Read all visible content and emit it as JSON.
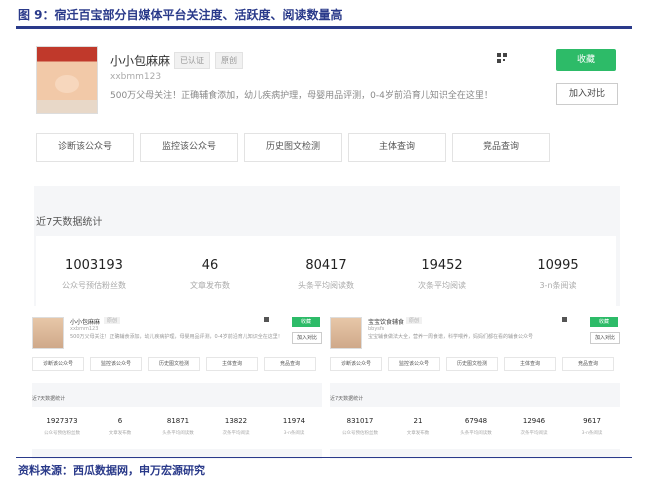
{
  "figure_title": "图 9：宿迁百宝部分自媒体平台关注度、活跃度、阅读数量高",
  "source": "资料来源：西瓜数据网，申万宏源研究",
  "main": {
    "name": "小小包麻麻",
    "tags": [
      "已认证",
      "原创"
    ],
    "id": "xxbmm123",
    "desc": "500万父母关注！正确辅食添加，幼儿疾病护理，母婴用品评测，0-4岁前沿育儿知识全在这里！",
    "collect": "收藏",
    "compare": "加入对比",
    "tabs": [
      "诊断该公众号",
      "监控该公众号",
      "历史图文检测",
      "主体查询",
      "竞品查询"
    ],
    "stats_title": "近7天数据统计",
    "stats": [
      {
        "value": "1003193",
        "label": "公众号预估粉丝数"
      },
      {
        "value": "46",
        "label": "文章发布数"
      },
      {
        "value": "80417",
        "label": "头条平均阅读数"
      },
      {
        "value": "19452",
        "label": "次条平均阅读"
      },
      {
        "value": "10995",
        "label": "3-n条阅读"
      }
    ]
  },
  "mini_left": {
    "name": "小小包麻麻",
    "tag": "原创",
    "id": "xxbmm123",
    "desc": "500万父母关注！正确辅食添加，幼儿疾病护理，母婴用品评测，0-4岁前沿育儿知识全在这里！",
    "collect": "收藏",
    "compare": "加入对比",
    "tabs": [
      "诊断该公众号",
      "监控该公众号",
      "历史图文检测",
      "主体查询",
      "竞品查询"
    ],
    "stats_title": "近7天数据统计",
    "stats": [
      {
        "value": "1927373",
        "label": "公众号预估粉丝数"
      },
      {
        "value": "6",
        "label": "文章发布数"
      },
      {
        "value": "81871",
        "label": "头条平均阅读数"
      },
      {
        "value": "13822",
        "label": "次条平均阅读"
      },
      {
        "value": "11974",
        "label": "3-n条阅读"
      }
    ]
  },
  "mini_right": {
    "name": "宝宝饮食辅食",
    "tag": "原创",
    "id": "bbysfs",
    "desc": "宝宝辅食做法大全，营养一周食谱，科学喂养，妈妈们都在看的辅食公众号",
    "collect": "收藏",
    "compare": "加入对比",
    "tabs": [
      "诊断该公众号",
      "监控该公众号",
      "历史图文检测",
      "主体查询",
      "竞品查询"
    ],
    "stats_title": "近7天数据统计",
    "stats": [
      {
        "value": "831017",
        "label": "公众号预估粉丝数"
      },
      {
        "value": "21",
        "label": "文章发布数"
      },
      {
        "value": "67948",
        "label": "头条平均阅读数"
      },
      {
        "value": "12946",
        "label": "次条平均阅读"
      },
      {
        "value": "9617",
        "label": "3-n条阅读"
      }
    ]
  }
}
